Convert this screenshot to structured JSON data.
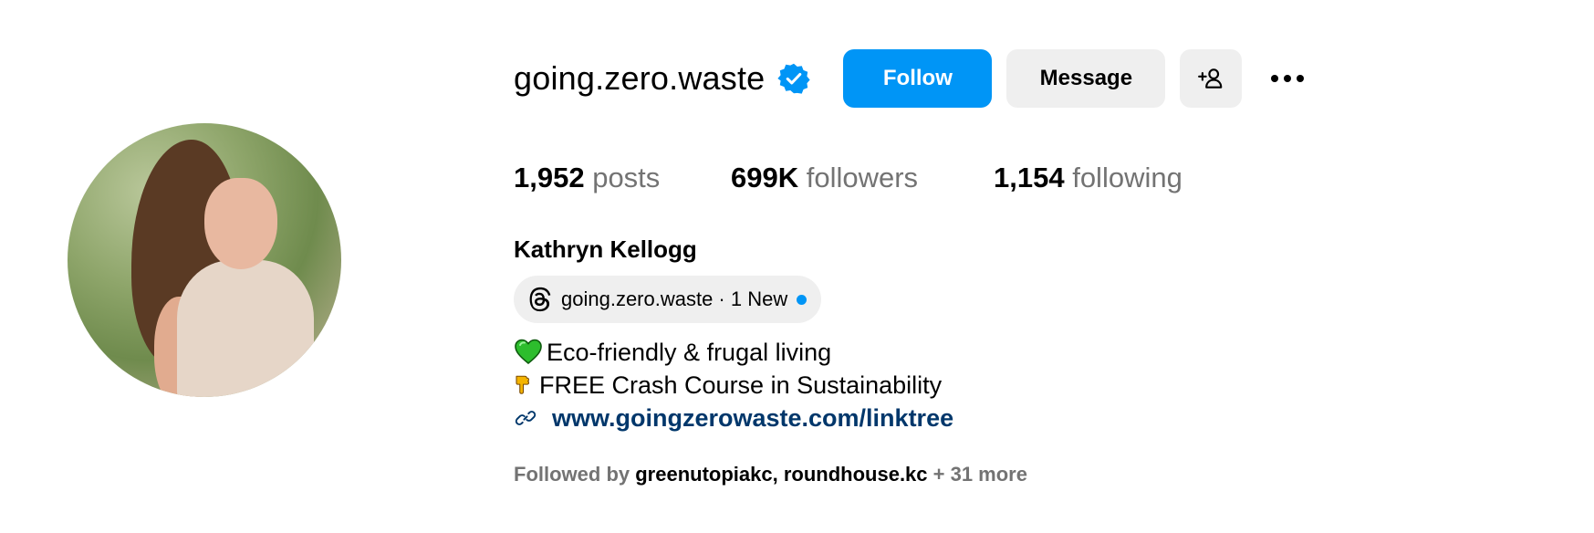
{
  "profile": {
    "username": "going.zero.waste",
    "verified": true,
    "follow_label": "Follow",
    "message_label": "Message",
    "full_name": "Kathryn Kellogg"
  },
  "stats": {
    "posts_count": "1,952",
    "posts_label": "posts",
    "followers_count": "699K",
    "followers_label": "followers",
    "following_count": "1,154",
    "following_label": "following"
  },
  "threads": {
    "text": "going.zero.waste · 1 New"
  },
  "bio": {
    "line1": "Eco-friendly & frugal living",
    "line2": "FREE Crash Course in Sustainability",
    "link": "www.goingzerowaste.com/linktree"
  },
  "followed_by": {
    "prefix": "Followed by ",
    "user1": "greenutopiakc",
    "separator": ", ",
    "user2": "roundhouse.kc",
    "suffix": " + 31 more"
  },
  "colors": {
    "accent": "#0095f6",
    "link": "#00376b",
    "muted": "#737373",
    "button_bg": "#efefef"
  }
}
